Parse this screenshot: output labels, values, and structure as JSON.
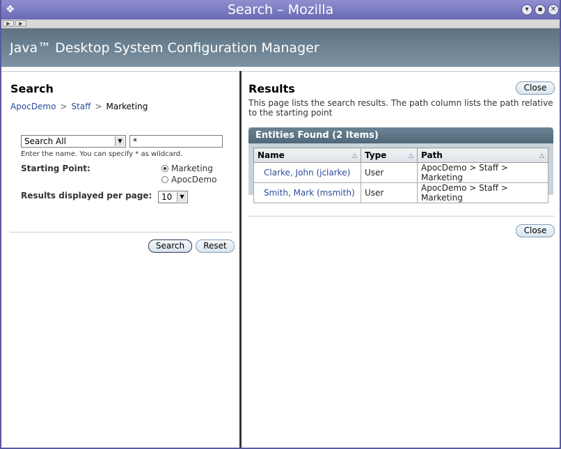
{
  "window": {
    "title": "Search – Mozilla"
  },
  "banner": {
    "title": "Java™ Desktop System Configuration Manager"
  },
  "search": {
    "heading": "Search",
    "breadcrumb": [
      "ApocDemo",
      "Staff",
      "Marketing"
    ],
    "breadcrumb_sep": ">",
    "filter_select": "Search All",
    "query_value": "*",
    "hint": "Enter the name. You can specify * as wildcard.",
    "starting_point_label": "Starting Point:",
    "starting_options": [
      "Marketing",
      "ApocDemo"
    ],
    "per_page_label": "Results displayed per page:",
    "per_page_value": "10",
    "search_button": "Search",
    "reset_button": "Reset"
  },
  "results": {
    "heading": "Results",
    "close_button": "Close",
    "description": "This page lists the search results. The path column lists the path relative to the starting point",
    "panel_title": "Entities Found (2 Items)",
    "columns": [
      "Name",
      "Type",
      "Path"
    ],
    "rows": [
      {
        "name": "Clarke, John (jclarke)",
        "type": "User",
        "path": "ApocDemo > Staff > Marketing"
      },
      {
        "name": "Smith, Mark (msmith)",
        "type": "User",
        "path": "ApocDemo > Staff > Marketing"
      }
    ]
  }
}
